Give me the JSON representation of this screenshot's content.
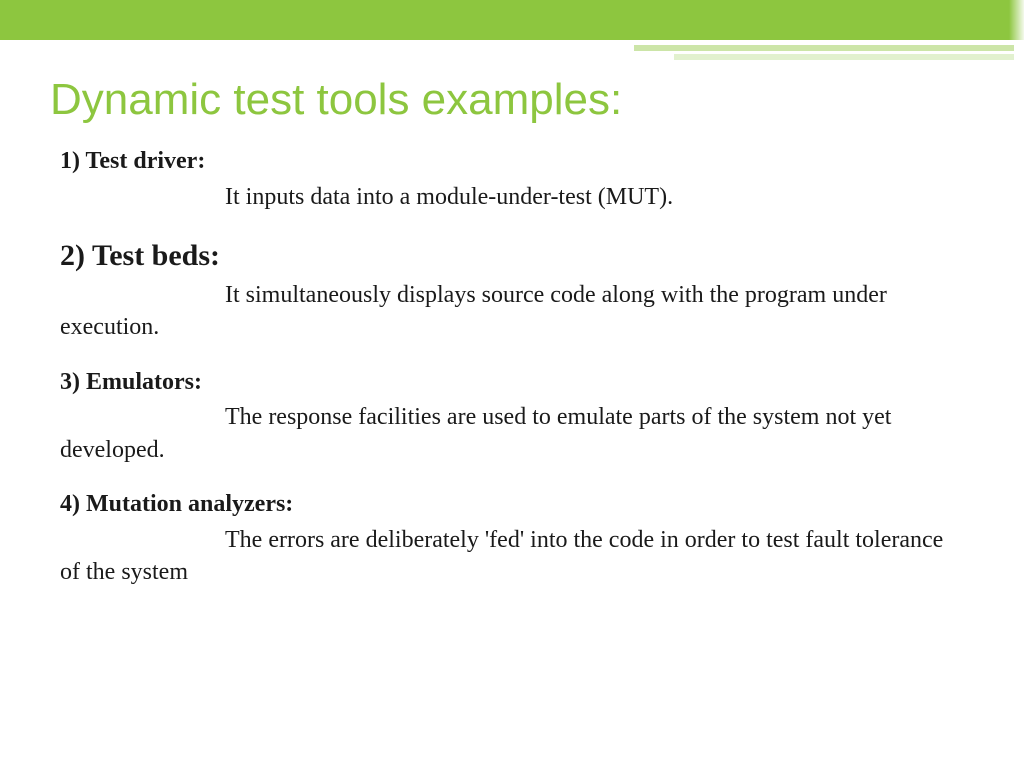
{
  "slide": {
    "title": "Dynamic test tools examples:",
    "items": [
      {
        "heading": "1) Test driver:",
        "heading_size": "normal",
        "description": "It inputs data into a module-under-test (MUT)."
      },
      {
        "heading": "2) Test beds:",
        "heading_size": "large",
        "description": "It simultaneously displays source code along with the program under execution."
      },
      {
        "heading": "3) Emulators:",
        "heading_size": "normal",
        "description": "The response facilities are used to emulate parts of the system not yet developed."
      },
      {
        "heading": "4) Mutation analyzers:",
        "heading_size": "normal",
        "description": "The errors are deliberately 'fed' into the code in order to test fault tolerance of the system"
      }
    ]
  },
  "colors": {
    "accent": "#8dc63f",
    "text": "#1a1a1a"
  }
}
